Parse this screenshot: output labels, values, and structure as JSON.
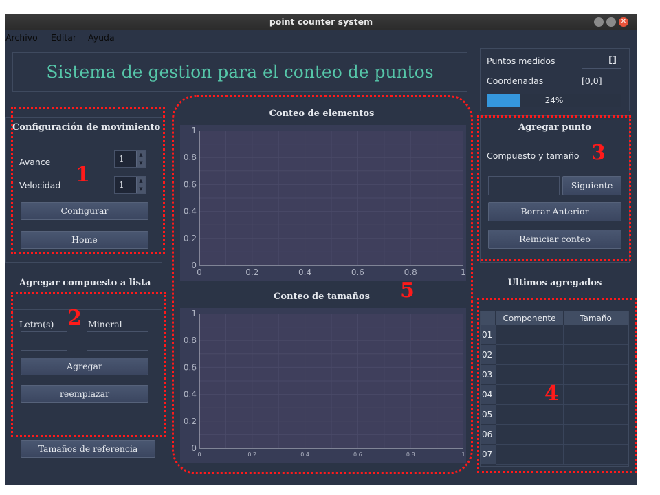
{
  "window": {
    "title": "point counter system"
  },
  "menu": {
    "archivo": "Archivo",
    "editar": "Editar",
    "ayuda": "Ayuda"
  },
  "app": {
    "title": "Sistema de gestion para el conteo de puntos"
  },
  "status": {
    "puntos_label": "Puntos   medidos",
    "puntos_value": "[]",
    "coords_label": "Coordenadas",
    "coords_value": "[0,0]",
    "progress": 24,
    "progress_text": "24%"
  },
  "movimiento": {
    "title": "Configuración de movimiento",
    "avance_label": "Avance",
    "avance_value": "1",
    "velocidad_label": "Velocidad",
    "velocidad_value": "1",
    "configurar": "Configurar",
    "home": "Home"
  },
  "compuesto": {
    "title": "Agregar compuesto a lista",
    "letras_label": "Letra(s)",
    "mineral_label": "Mineral",
    "agregar": "Agregar",
    "reemplazar": "reemplazar"
  },
  "referencia_button": "Tamaños de referencia",
  "agregar_punto": {
    "title": "Agregar punto",
    "compuesto_label": "Compuesto y tamaño",
    "siguiente": "Siguiente",
    "borrar": "Borrar Anterior",
    "reiniciar": "Reiniciar conteo"
  },
  "ultimos": {
    "title": "Ultimos  agregados",
    "columns": [
      "Componente",
      "Tamaño"
    ],
    "rows": [
      "01",
      "02",
      "03",
      "04",
      "05",
      "06",
      "07"
    ]
  },
  "chart_data": [
    {
      "type": "bar",
      "title": "Conteo de elementos",
      "xlim": [
        0,
        1
      ],
      "ylim": [
        0,
        1
      ],
      "xticks": [
        "0",
        "0.2",
        "0.4",
        "0.6",
        "0.8",
        "1"
      ],
      "yticks": [
        "0",
        "0.2",
        "0.4",
        "0.6",
        "0.8",
        "1"
      ],
      "series": []
    },
    {
      "type": "bar",
      "title": "Conteo de tamaños",
      "xlim": [
        0,
        1
      ],
      "ylim": [
        0,
        1
      ],
      "xticks": [
        "0",
        "0.2",
        "0.4",
        "0.6",
        "0.8",
        "1"
      ],
      "yticks": [
        "0",
        "0.2",
        "0.4",
        "0.6",
        "0.8",
        "1"
      ],
      "series": []
    }
  ],
  "annotations": [
    "1",
    "2",
    "3",
    "4",
    "5"
  ],
  "colors": {
    "accent": "#56c6a9",
    "progress": "#3597dd",
    "annotation": "#ff1a1a",
    "background": "#2b3446"
  }
}
